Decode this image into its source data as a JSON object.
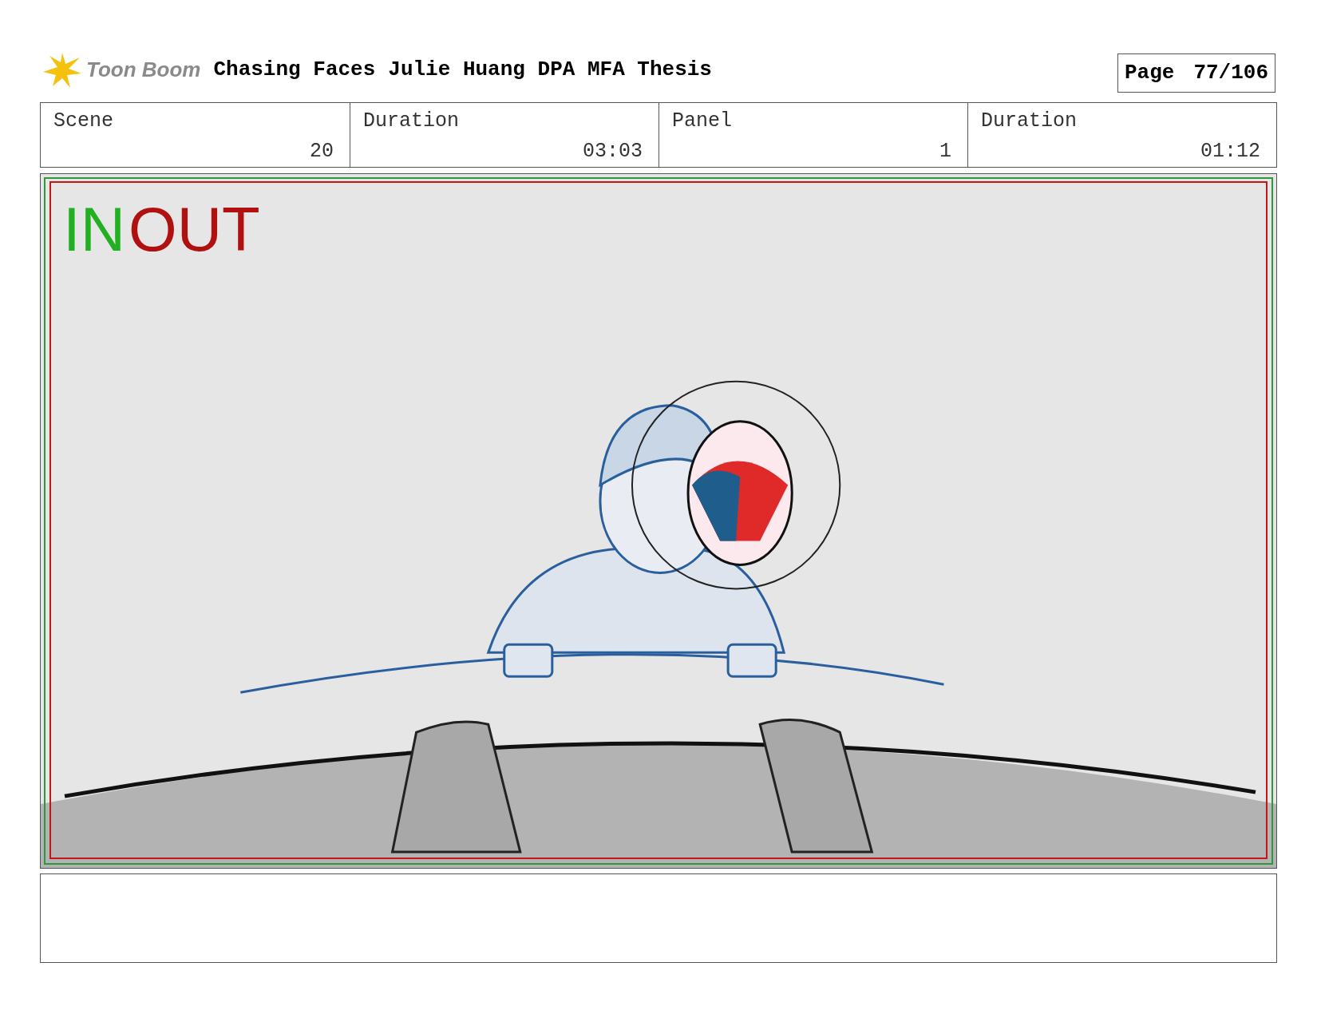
{
  "header": {
    "logo_text": "Toon Boom",
    "project": "Chasing Faces",
    "subtitle": "Julie Huang DPA MFA Thesis",
    "page_label": "Page",
    "page_number": "77/106"
  },
  "info": [
    {
      "label": "Scene",
      "value": "20"
    },
    {
      "label": "Duration",
      "value": "03:03"
    },
    {
      "label": "Panel",
      "value": "1"
    },
    {
      "label": "Duration",
      "value": "01:12"
    }
  ],
  "panel": {
    "in_label": "IN",
    "out_label": "OUT"
  }
}
